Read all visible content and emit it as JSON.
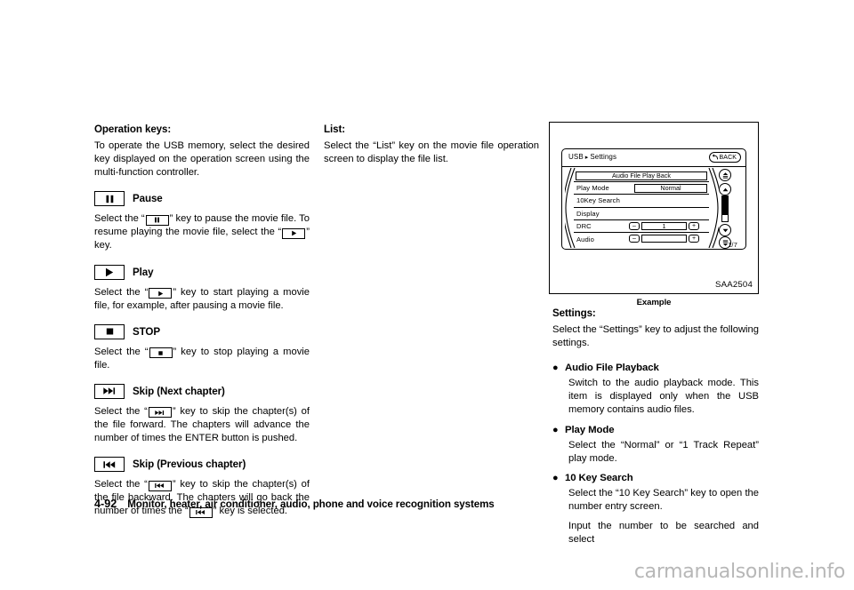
{
  "left_column": {
    "heading": "Operation keys:",
    "intro": "To operate the USB memory, select the desired key displayed on the operation screen using the multi-function controller.",
    "keys": [
      {
        "icon": "pause-icon",
        "label": "Pause",
        "text_before": "Select the “",
        "text_mid": "” key to pause the movie file. To resume playing the movie file, select the “",
        "text_after": "” key."
      },
      {
        "icon": "play-icon",
        "label": "Play",
        "text_before": "Select the “",
        "text_mid": "” key to start playing a movie file, for example, after pausing a movie file.",
        "text_after": ""
      },
      {
        "icon": "stop-icon",
        "label": "STOP",
        "text_before": "Select the “",
        "text_mid": "” key to stop playing a movie file.",
        "text_after": ""
      },
      {
        "icon": "skip-next-icon",
        "label": "Skip (Next chapter)",
        "text_before": "Select the “",
        "text_mid": "” key to skip the chapter(s) of the file forward. The chapters will advance the number of times the ENTER button is pushed.",
        "text_after": ""
      },
      {
        "icon": "skip-previous-icon",
        "label": "Skip (Previous chapter)",
        "text_before": "Select the “",
        "text_mid": "” key to skip the chapter(s) of the file backward. The chapters will go back the number of times the “",
        "text_after": "” key is selected."
      }
    ]
  },
  "mid_column": {
    "heading": "List:",
    "text": "Select the “List” key on the movie file operation screen to display the file list."
  },
  "figure": {
    "code": "SAA2504",
    "caption": "Example",
    "screen": {
      "breadcrumb_root": "USB",
      "breadcrumb_sep": "▸",
      "breadcrumb_leaf": "Settings",
      "back_label": "BACK",
      "page_indicator": "1/7",
      "rows": [
        {
          "name": "audio-file-play-back",
          "label": "",
          "value": "Audio File Play Back",
          "type": "wide-button"
        },
        {
          "name": "play-mode",
          "label": "Play Mode",
          "value": "Normal",
          "type": "value-button"
        },
        {
          "name": "10key-search",
          "label": "10Key Search",
          "value": "",
          "type": "plain"
        },
        {
          "name": "display",
          "label": "Display",
          "value": "",
          "type": "plain"
        },
        {
          "name": "drc",
          "label": "DRC",
          "value": "1",
          "type": "stepper",
          "minus": "–",
          "plus": "+"
        },
        {
          "name": "audio",
          "label": "Audio",
          "value": "",
          "type": "stepper",
          "minus": "–",
          "plus": "+"
        }
      ]
    }
  },
  "right_column": {
    "heading": "Settings:",
    "intro": "Select the “Settings” key to adjust the following settings.",
    "bullet_char": "●",
    "items": [
      {
        "title": "Audio File Playback",
        "paragraphs": [
          "Switch to the audio playback mode. This item is displayed only when the USB memory contains audio files."
        ]
      },
      {
        "title": "Play Mode",
        "paragraphs": [
          "Select the “Normal” or “1 Track Repeat” play mode."
        ]
      },
      {
        "title": "10 Key Search",
        "paragraphs": [
          "Select the “10 Key Search” key to open the number entry screen.",
          "Input the number to be searched and select"
        ]
      }
    ]
  },
  "footer": {
    "page_number": "4-92",
    "section_title": "Monitor, heater, air conditioner, audio, phone and voice recognition systems"
  },
  "watermark": "carmanualsonline.info",
  "colors": {
    "ink": "#000000",
    "paper": "#ffffff",
    "watermark": "#b7b7b7"
  }
}
